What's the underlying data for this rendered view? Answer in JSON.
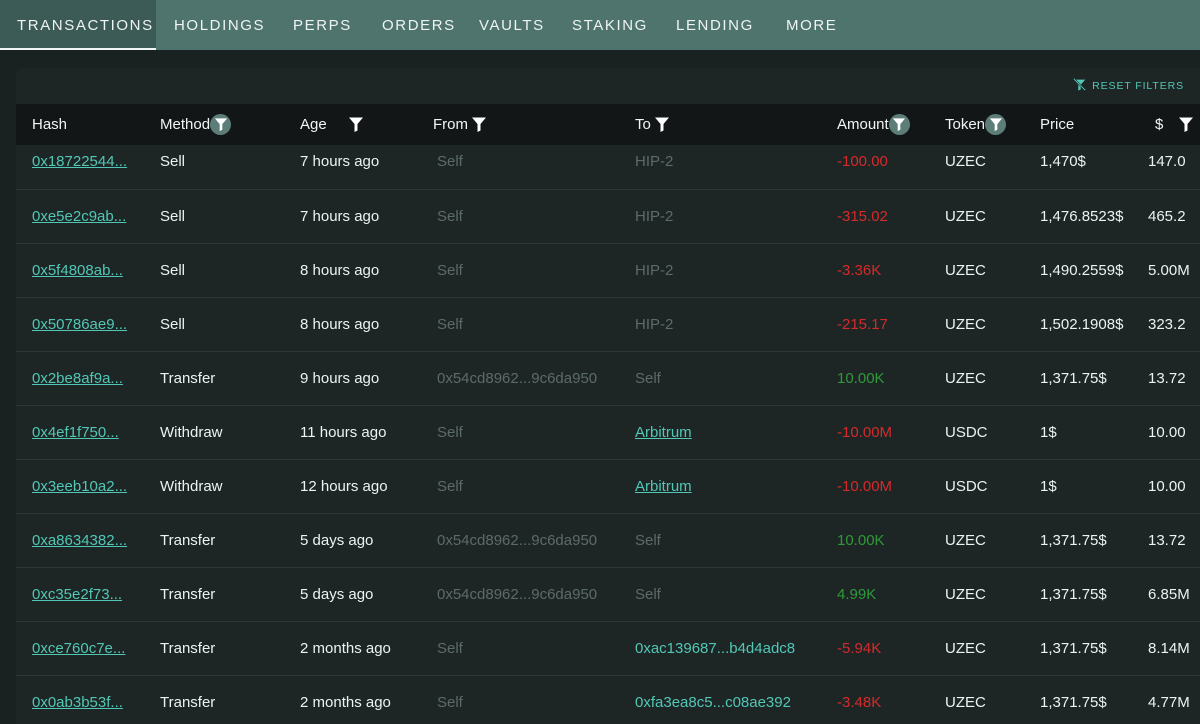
{
  "tabs": [
    {
      "label": "TRANSACTIONS",
      "active": true
    },
    {
      "label": "HOLDINGS"
    },
    {
      "label": "PERPS"
    },
    {
      "label": "ORDERS"
    },
    {
      "label": "VAULTS"
    },
    {
      "label": "STAKING"
    },
    {
      "label": "LENDING"
    },
    {
      "label": "MORE"
    }
  ],
  "reset_filters_label": "RESET FILTERS",
  "columns": {
    "hash": "Hash",
    "method": "Method",
    "age": "Age",
    "from": "From",
    "to": "To",
    "amount": "Amount",
    "token": "Token",
    "price": "Price",
    "usd": "$"
  },
  "rows": [
    {
      "hash": "0x18722544...",
      "method": "Sell",
      "age": "7 hours ago",
      "from": "Self",
      "to": "HIP-2",
      "amount": "-100.00",
      "token": "UZEC",
      "price": "1,470$",
      "usd": "147.0"
    },
    {
      "hash": "0xe5e2c9ab...",
      "method": "Sell",
      "age": "7 hours ago",
      "from": "Self",
      "to": "HIP-2",
      "amount": "-315.02",
      "token": "UZEC",
      "price": "1,476.8523$",
      "usd": "465.2"
    },
    {
      "hash": "0x5f4808ab...",
      "method": "Sell",
      "age": "8 hours ago",
      "from": "Self",
      "to": "HIP-2",
      "amount": "-3.36K",
      "token": "UZEC",
      "price": "1,490.2559$",
      "usd": "5.00M"
    },
    {
      "hash": "0x50786ae9...",
      "method": "Sell",
      "age": "8 hours ago",
      "from": "Self",
      "to": "HIP-2",
      "amount": "-215.17",
      "token": "UZEC",
      "price": "1,502.1908$",
      "usd": "323.2"
    },
    {
      "hash": "0x2be8af9a...",
      "method": "Transfer",
      "age": "9 hours ago",
      "from": "0x54cd8962...9c6da950",
      "to": "Self",
      "amount": "10.00K",
      "token": "UZEC",
      "price": "1,371.75$",
      "usd": "13.72"
    },
    {
      "hash": "0x4ef1f750...",
      "method": "Withdraw",
      "age": "11 hours ago",
      "from": "Self",
      "to": "Arbitrum",
      "amount": "-10.00M",
      "token": "USDC",
      "price": "1$",
      "usd": "10.00"
    },
    {
      "hash": "0x3eeb10a2...",
      "method": "Withdraw",
      "age": "12 hours ago",
      "from": "Self",
      "to": "Arbitrum",
      "amount": "-10.00M",
      "token": "USDC",
      "price": "1$",
      "usd": "10.00"
    },
    {
      "hash": "0xa8634382...",
      "method": "Transfer",
      "age": "5 days ago",
      "from": "0x54cd8962...9c6da950",
      "to": "Self",
      "amount": "10.00K",
      "token": "UZEC",
      "price": "1,371.75$",
      "usd": "13.72"
    },
    {
      "hash": "0xc35e2f73...",
      "method": "Transfer",
      "age": "5 days ago",
      "from": "0x54cd8962...9c6da950",
      "to": "Self",
      "amount": "4.99K",
      "token": "UZEC",
      "price": "1,371.75$",
      "usd": "6.85M"
    },
    {
      "hash": "0xce760c7e...",
      "method": "Transfer",
      "age": "2 months ago",
      "from": "Self",
      "to": "0xac139687...b4d4adc8",
      "amount": "-5.94K",
      "token": "UZEC",
      "price": "1,371.75$",
      "usd": "8.14M"
    },
    {
      "hash": "0x0ab3b53f...",
      "method": "Transfer",
      "age": "2 months ago",
      "from": "Self",
      "to": "0xfa3ea8c5...c08ae392",
      "amount": "-3.48K",
      "token": "UZEC",
      "price": "1,371.75$",
      "usd": "4.77M"
    }
  ],
  "colors": {
    "tabbar": "#4f746d",
    "accent": "#52c7b6",
    "negative": "#d62a2a",
    "positive": "#2f9a3a",
    "muted": "#5c6b69"
  },
  "icons": {
    "filter": "filter-icon",
    "reset": "filter-reset-icon"
  }
}
